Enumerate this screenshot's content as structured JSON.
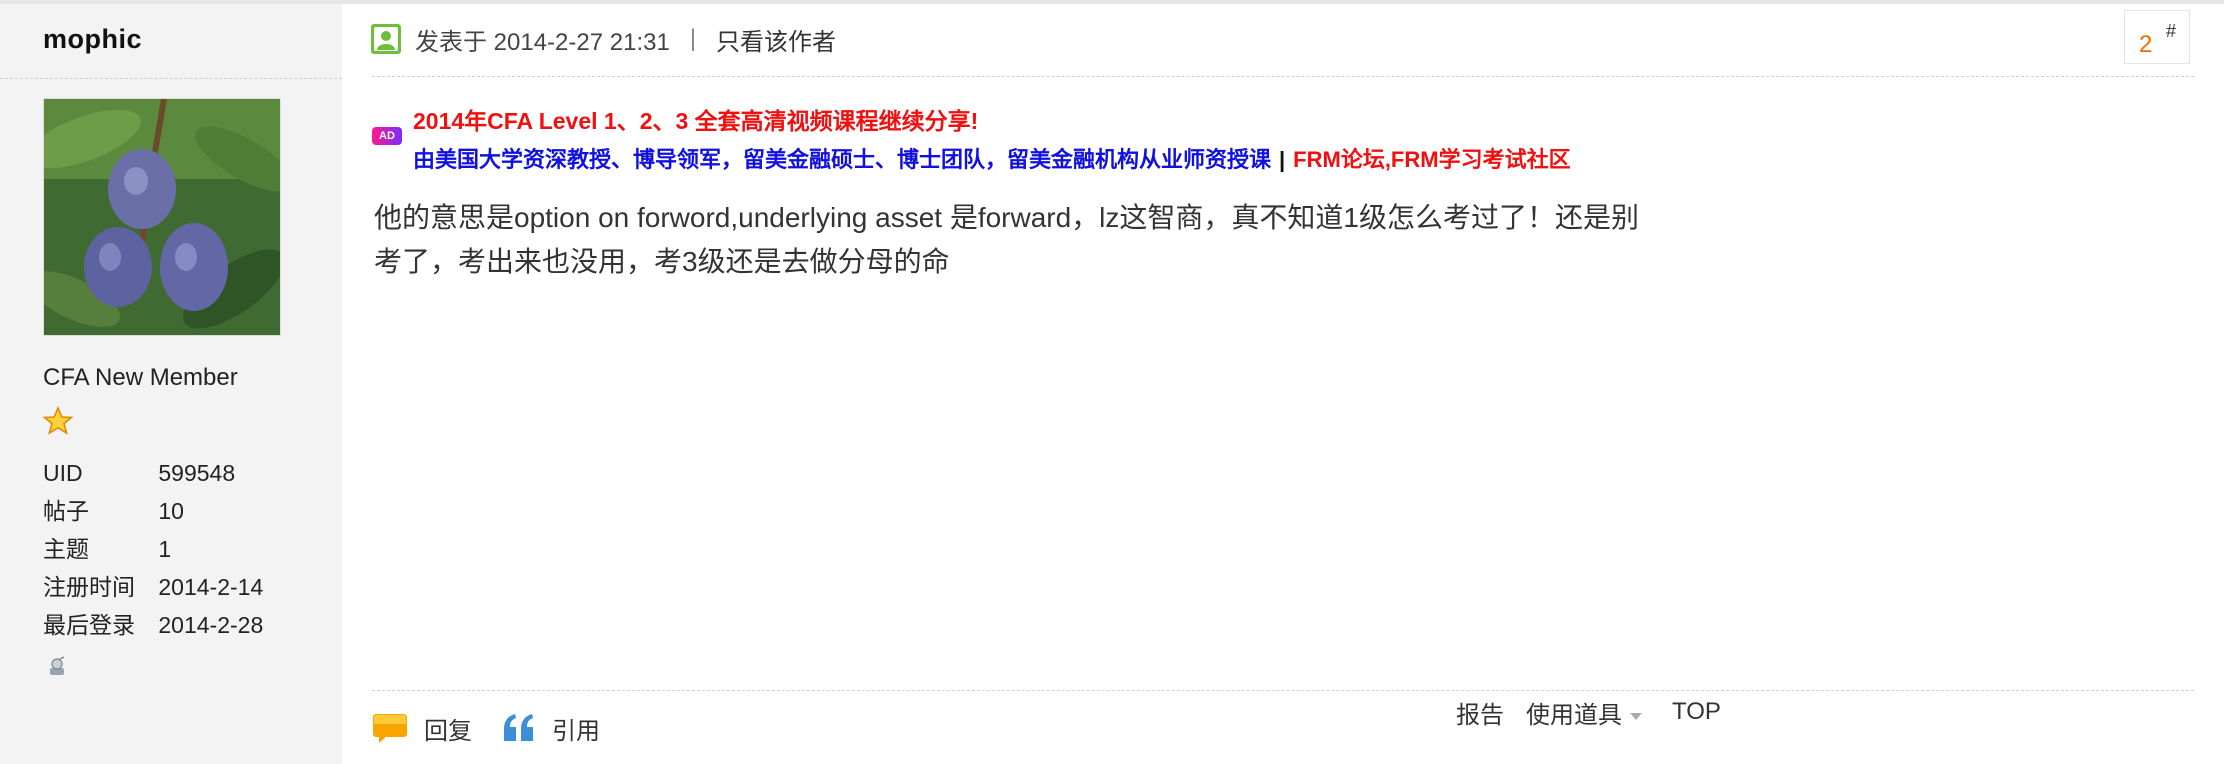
{
  "author": {
    "username": "mophic",
    "rank": "CFA New Member",
    "stats": [
      {
        "label": "UID",
        "value": "599548"
      },
      {
        "label": "帖子",
        "value": "10"
      },
      {
        "label": "主题",
        "value": "1"
      },
      {
        "label": "注册时间",
        "value": "2014-2-14"
      },
      {
        "label": "最后登录",
        "value": "2014-2-28"
      }
    ]
  },
  "post": {
    "posted_at": "发表于 2014-2-27 21:31",
    "separator": "|",
    "author_only": "只看该作者",
    "floor_number": "2",
    "floor_symbol": "#",
    "ad": {
      "badge": "AD",
      "line1": "2014年CFA Level 1、2、3 全套高清视频课程继续分享!",
      "line2": "由美国大学资深教授、博导领军，留美金融硕士、博士团队，留美金融机构从业师资授课",
      "line2_separator": "|",
      "line2_link": "FRM论坛,FRM学习考试社区"
    },
    "content_line1": "他的意思是option on forword,underlying asset 是forward，lz这智商，真不知道1级怎么考过了！还是别",
    "content_line2": "考了，考出来也没用，考3级还是去做分母的命"
  },
  "actions": {
    "reply": "回复",
    "quote": "引用",
    "report": "报告",
    "use_item": "使用道具",
    "top": "TOP"
  },
  "colors": {
    "ad_red": "#f01010",
    "ad_blue": "#1010e0",
    "floor_orange": "#f26c00",
    "sidebar_bg": "#f3f3f3"
  }
}
